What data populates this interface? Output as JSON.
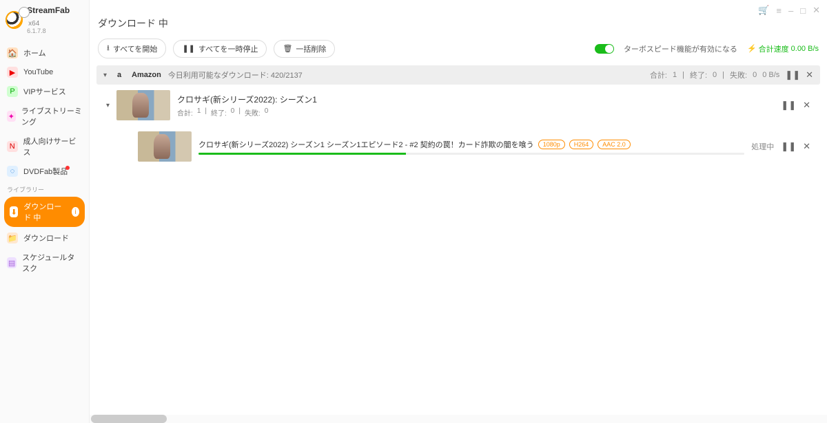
{
  "brand": {
    "name": "StreamFab",
    "edition": "x64",
    "version": "6.1.7.8"
  },
  "titlebarIcons": {
    "a": "🛒",
    "b": "≡",
    "c": "–",
    "d": "□",
    "e": "✕"
  },
  "nav": {
    "home": "ホーム",
    "youtube": "YouTube",
    "vip": "VIPサービス",
    "live": "ライブストリーミング",
    "adult": "成人向けサービス",
    "dvdfab": "DVDFab製品",
    "libLabel": "ライブラリー",
    "downloading": "ダウンロード 中",
    "downloaded": "ダウンロード",
    "schedule": "スケジュールタスク"
  },
  "pageTitle": "ダウンロード 中",
  "toolbar": {
    "startAll": "すべてを開始",
    "pauseAll": "すべてを一時停止",
    "deleteAll": "一括削除"
  },
  "turbo": {
    "label": "ターボスピード機能が有効になる"
  },
  "speed": {
    "label": "合計速度",
    "value": "0.00 B/s"
  },
  "group": {
    "service": "Amazon",
    "sub": "今日利用可能なダウンロード: 420/2137",
    "totalLbl": "合計:",
    "total": "1",
    "doneLbl": "終了:",
    "done": "0",
    "failLbl": "失敗:",
    "fail": "0",
    "rate": "0 B/s"
  },
  "season": {
    "title": "クロサギ(新シリーズ2022): シーズン1",
    "totalLbl": "合計:",
    "total": "1",
    "doneLbl": "終了:",
    "done": "0",
    "failLbl": "失敗:",
    "fail": "0"
  },
  "episode": {
    "title": "クロサギ(新シリーズ2022) シーズン1 シーズン1エピソード2 - #2 契約の罠！カード詐欺の闇を喰う",
    "chipRes": "1080p",
    "chipCodec": "H264",
    "chipAudio": "AAC 2.0",
    "status": "処理中"
  }
}
